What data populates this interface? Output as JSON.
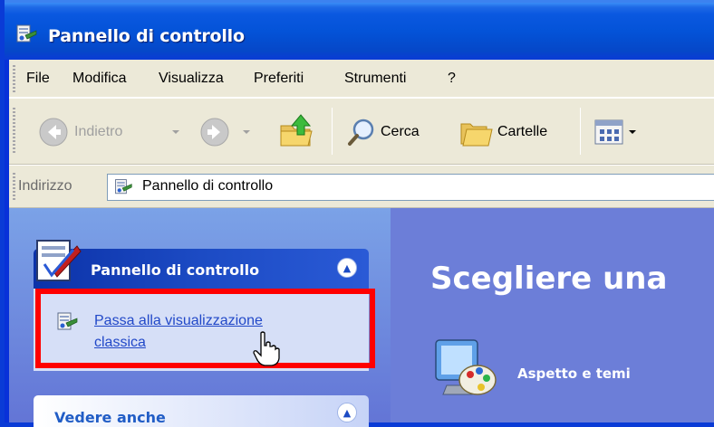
{
  "window": {
    "title": "Pannello di controllo"
  },
  "menubar": {
    "items": [
      "File",
      "Modifica",
      "Visualizza",
      "Preferiti",
      "Strumenti",
      "?"
    ]
  },
  "toolbar": {
    "back_label": "Indietro",
    "search_label": "Cerca",
    "folders_label": "Cartelle"
  },
  "address": {
    "label": "Indirizzo",
    "value": "Pannello di controllo"
  },
  "taskpane": {
    "control_panel": {
      "title": "Pannello di controllo",
      "link_line1": "Passa alla visualizzazione",
      "link_line2": "classica"
    },
    "see_also": {
      "title": "Vedere anche"
    }
  },
  "main": {
    "heading": "Scegliere una",
    "category": "Aspetto e temi"
  },
  "colors": {
    "title_blue": "#0453d8",
    "chrome": "#ece9d8",
    "link": "#2148c8",
    "highlight": "#ff0000",
    "main_bg": "#6c7ed8"
  },
  "icons": [
    "control-panel-icon",
    "back-arrow-icon",
    "forward-arrow-icon",
    "up-folder-icon",
    "search-icon",
    "folders-icon",
    "views-icon",
    "hand-cursor-icon",
    "appearance-themes-icon"
  ]
}
